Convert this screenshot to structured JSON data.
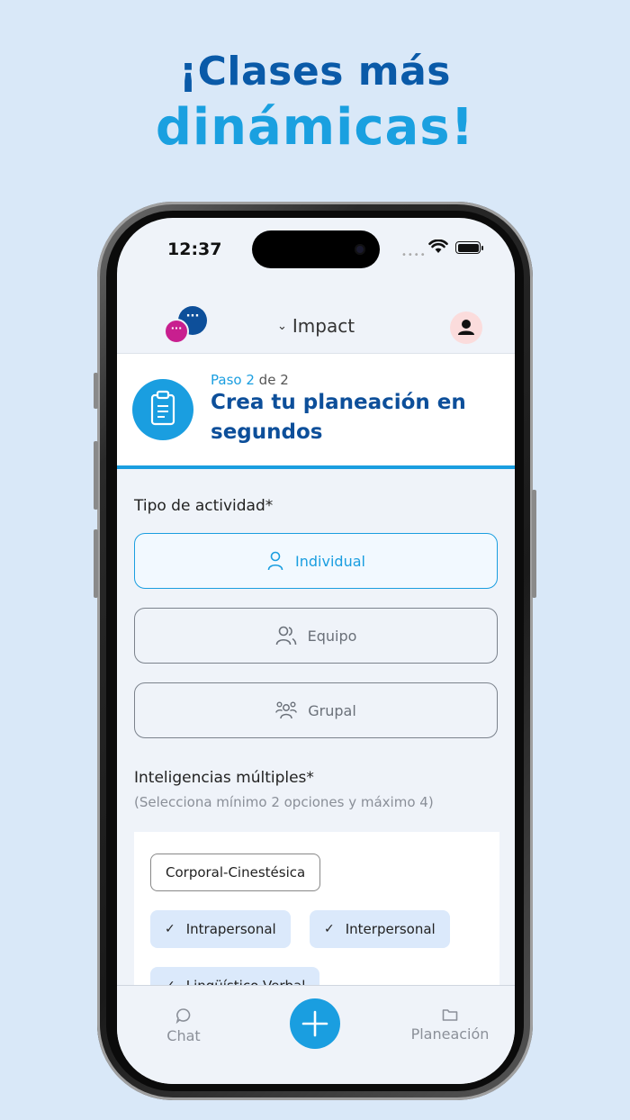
{
  "headline": {
    "line1": "¡Clases más",
    "line2": "dinámicas!"
  },
  "status_bar": {
    "time": "12:37"
  },
  "app_bar": {
    "org_name": "Impact",
    "logo_dots": "···"
  },
  "step": {
    "prefix": "Paso",
    "current": "2",
    "of": "de",
    "total": "2",
    "title": "Crea tu planeación en segundos"
  },
  "activity": {
    "label": "Tipo de actividad*",
    "options": [
      {
        "label": "Individual",
        "selected": true,
        "icon": "person-icon"
      },
      {
        "label": "Equipo",
        "selected": false,
        "icon": "people-icon"
      },
      {
        "label": "Grupal",
        "selected": false,
        "icon": "group-icon"
      }
    ]
  },
  "intelligences": {
    "label": "Inteligencias múltiples*",
    "hint": "(Selecciona mínimo 2 opciones y máximo 4)",
    "chips": [
      {
        "label": "Corporal-Cinestésica",
        "selected": false
      },
      {
        "label": "Intrapersonal",
        "selected": true,
        "check": "✓"
      },
      {
        "label": "Interpersonal",
        "selected": true,
        "check": "✓"
      },
      {
        "label": "Lingüístico-Verbal",
        "selected": true,
        "check": "✓"
      }
    ]
  },
  "tab_bar": {
    "chat": "Chat",
    "planning": "Planeación"
  },
  "colors": {
    "brand_dark": "#0d4f9a",
    "brand_accent": "#1a9ee0",
    "magenta": "#c81f8f",
    "background": "#d9e8f8"
  }
}
